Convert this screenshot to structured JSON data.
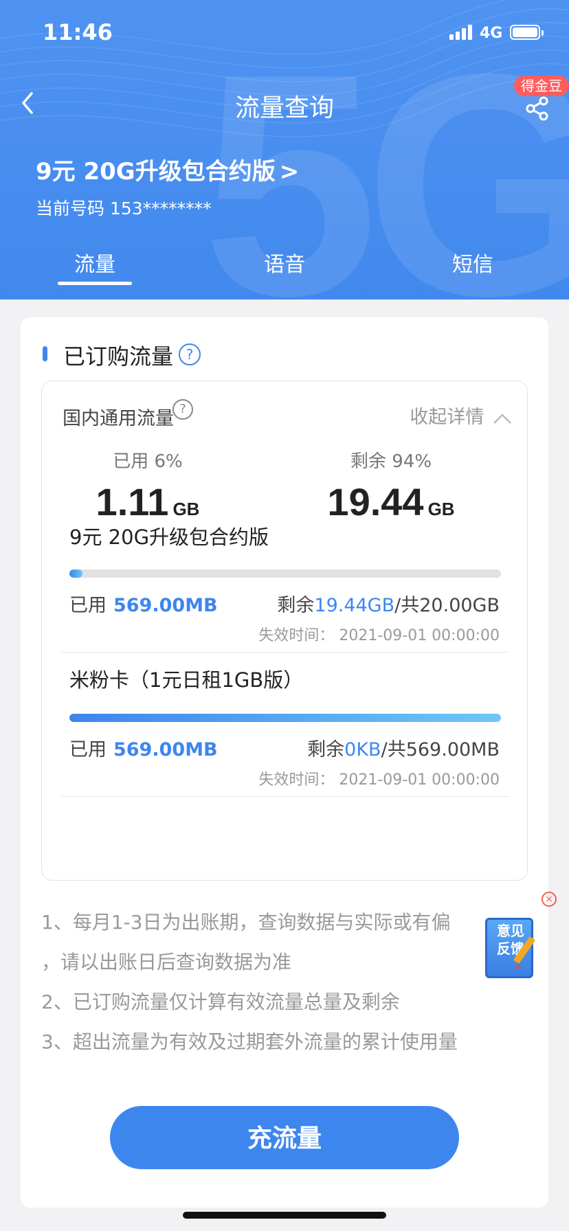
{
  "status_bar": {
    "time": "11:46",
    "network": "4G"
  },
  "header": {
    "title": "流量查询",
    "badge": "得金豆",
    "plan_name": "9元 20G升级包合约版",
    "plan_chevron": ">",
    "phone_label": "当前号码",
    "phone_number": "153********",
    "bg_text": "5G"
  },
  "tabs": [
    {
      "label": "流量",
      "active": true
    },
    {
      "label": "语音",
      "active": false
    },
    {
      "label": "短信",
      "active": false
    }
  ],
  "section": {
    "title": "已订购流量",
    "help": "?"
  },
  "domestic": {
    "title": "国内通用流量",
    "help": "?",
    "collapse_label": "收起详情",
    "used_label": "已用 6%",
    "used_value": "1.11",
    "remain_label": "剩余 94%",
    "remain_value": "19.44",
    "unit": "GB"
  },
  "packages": [
    {
      "name": "9元 20G升级包合约版",
      "progress_fraction": 0.03,
      "used_label": "已用",
      "used_value": "569.00MB",
      "remain_label": "剩余",
      "remain_value": "19.44GB",
      "total_label": "/共",
      "total_value": "20.00GB",
      "expire": "失效时间：  2021-09-01 00:00:00"
    },
    {
      "name": "米粉卡（1元日租1GB版）",
      "progress_fraction": 1.0,
      "used_label": "已用",
      "used_value": "569.00MB",
      "remain_label": "剩余",
      "remain_value": "0KB",
      "total_label": "/共",
      "total_value": "569.00MB",
      "expire": "失效时间：  2021-09-01 00:00:00"
    }
  ],
  "notes": [
    "1、每月1-3日为出账期，查询数据与实际或有偏",
    "，请以出账日后查询数据为准",
    "2、已订购流量仅计算有效流量总量及剩余",
    "3、超出流量为有效及过期套外流量的累计使用量"
  ],
  "feedback": {
    "line1": "意见",
    "line2": "反馈",
    "close": "×"
  },
  "recharge_button": "充流量",
  "colors": {
    "primary": "#3d86ee",
    "header_bg": "#4289ee",
    "badge": "#ff5d5d"
  }
}
